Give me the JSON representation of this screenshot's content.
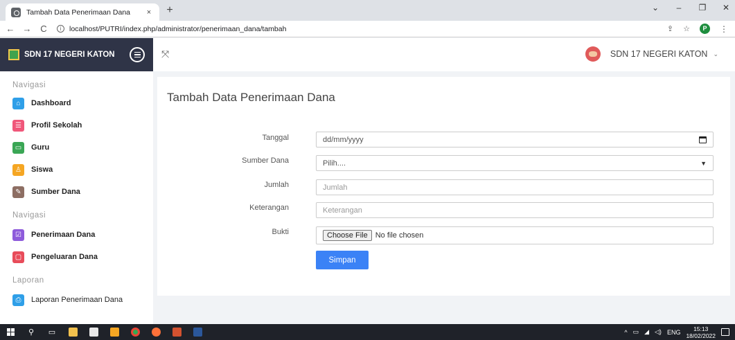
{
  "browser": {
    "tab_title": "Tambah Data Penerimaan Dana",
    "tab_close": "×",
    "new_tab": "+",
    "url": "localhost/PUTRI/index.php/administrator/penerimaan_dana/tambah",
    "profile_initial": "P"
  },
  "sidebar": {
    "brand": "SDN 17 NEGERI KATON",
    "sections": [
      {
        "header": "Navigasi",
        "items": [
          {
            "label": "Dashboard",
            "icon": "home-icon",
            "color": "#2f9fe8"
          },
          {
            "label": "Profil Sekolah",
            "icon": "list-icon",
            "color": "#f0577a"
          },
          {
            "label": "Guru",
            "icon": "monitor-icon",
            "color": "#3aa655"
          },
          {
            "label": "Siswa",
            "icon": "user-icon",
            "color": "#f5a623"
          },
          {
            "label": "Sumber Dana",
            "icon": "edit-icon",
            "color": "#8d6e63"
          }
        ]
      },
      {
        "header": "Navigasi",
        "items": [
          {
            "label": "Penerimaan Dana",
            "icon": "checkbox-icon",
            "color": "#8e5bdb"
          },
          {
            "label": "Pengeluaran Dana",
            "icon": "chat-icon",
            "color": "#e84c5a"
          }
        ]
      },
      {
        "header": "Laporan",
        "items": [
          {
            "label": "Laporan Penerimaan Dana",
            "icon": "printer-icon",
            "color": "#2f9fe8"
          }
        ]
      }
    ]
  },
  "header": {
    "user_name": "SDN 17 NEGERI KATON"
  },
  "form": {
    "title": "Tambah Data Penerimaan Dana",
    "tanggal_label": "Tanggal",
    "tanggal_placeholder": "dd/mm/yyyy",
    "sumber_label": "Sumber Dana",
    "sumber_selected": "Pilih....",
    "jumlah_label": "Jumlah",
    "jumlah_placeholder": "Jumlah",
    "keterangan_label": "Keterangan",
    "keterangan_placeholder": "Keterangan",
    "bukti_label": "Bukti",
    "choose_file": "Choose File",
    "file_status": "No file chosen",
    "submit": "Simpan"
  },
  "taskbar": {
    "language": "ENG",
    "time": "15:13",
    "date": "18/02/2022"
  },
  "colors": {
    "sidebar_brand_bg": "#2f3447",
    "primary_button": "#3b82f6",
    "taskbar_bg": "#1f2229"
  }
}
